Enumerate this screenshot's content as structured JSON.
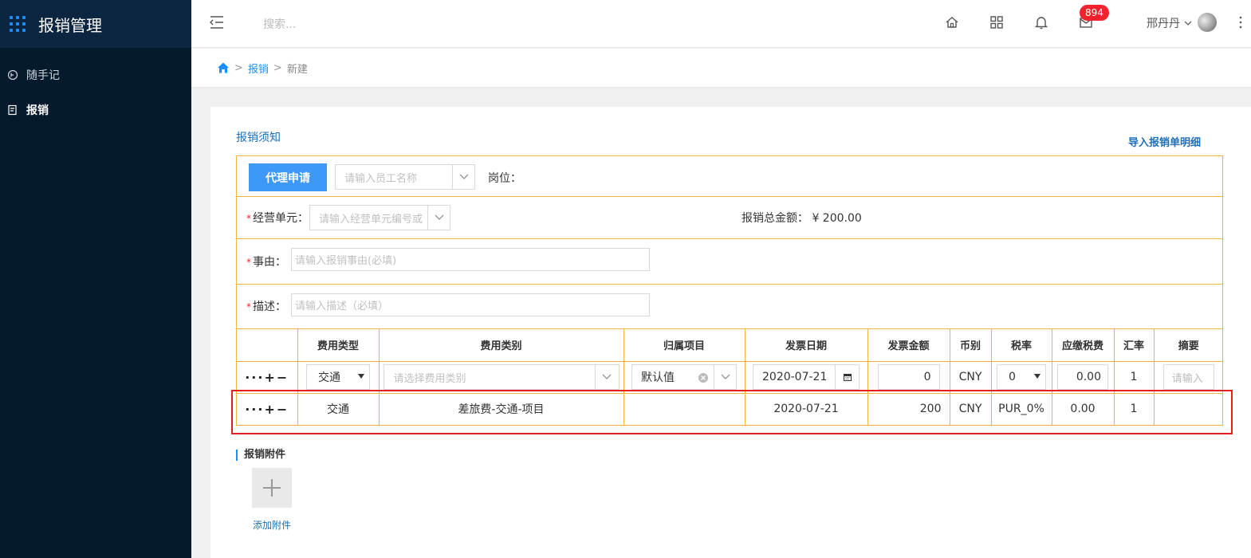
{
  "app": {
    "title": "报销管理"
  },
  "sidebar": {
    "items": [
      {
        "label": "随手记",
        "icon": "notebook-icon",
        "active": false
      },
      {
        "label": "报销",
        "icon": "receipt-icon",
        "active": true
      }
    ]
  },
  "header": {
    "search_placeholder": "搜索...",
    "mail_badge": "894",
    "user_name": "邢丹丹"
  },
  "breadcrumb": {
    "sep": ">",
    "items": [
      "报销",
      "新建"
    ]
  },
  "card": {
    "notice_link": "报销须知",
    "import_link": "导入报销单明细"
  },
  "form": {
    "proxy_button": "代理申请",
    "employee_placeholder": "请输入员工名称",
    "position_label": "岗位：",
    "required_mark": "*",
    "unit_label": "经营单元：",
    "unit_placeholder": "请输入经营单元编号或",
    "total_label": "报销总金额：",
    "total_value": "¥ 200.00",
    "reason_label": "事由：",
    "reason_placeholder": "请输入报销事由(必填)",
    "desc_label": "描述：",
    "desc_placeholder": "请输入描述（必填）"
  },
  "table": {
    "headers": [
      "",
      "费用类型",
      "费用类别",
      "归属项目",
      "发票日期",
      "发票金额",
      "币别",
      "税率",
      "应缴税费",
      "汇率",
      "摘要"
    ],
    "edit_row": {
      "ops": "···+−",
      "expense_type": "交通",
      "category_placeholder": "请选择费用类别",
      "project": "默认值",
      "invoice_date": "2020-07-21",
      "amount": "0",
      "currency": "CNY",
      "tax_rate": "0",
      "tax_fee": "0.00",
      "exchange_rate": "1",
      "summary_placeholder": "请输入"
    },
    "data_row": {
      "ops": "···+−",
      "expense_type": "交通",
      "category": "差旅费-交通-项目",
      "project": "",
      "invoice_date": "2020-07-21",
      "amount": "200",
      "currency": "CNY",
      "tax_rate": "PUR_0%",
      "tax_fee": "0.00",
      "exchange_rate": "1",
      "summary": ""
    }
  },
  "attachments": {
    "title": "报销附件",
    "add_label": "添加附件"
  },
  "colors": {
    "sidebar_bg": "#061a2e",
    "accent": "#1890ff",
    "table_border": "#f0b43c",
    "highlight": "#e62020"
  }
}
